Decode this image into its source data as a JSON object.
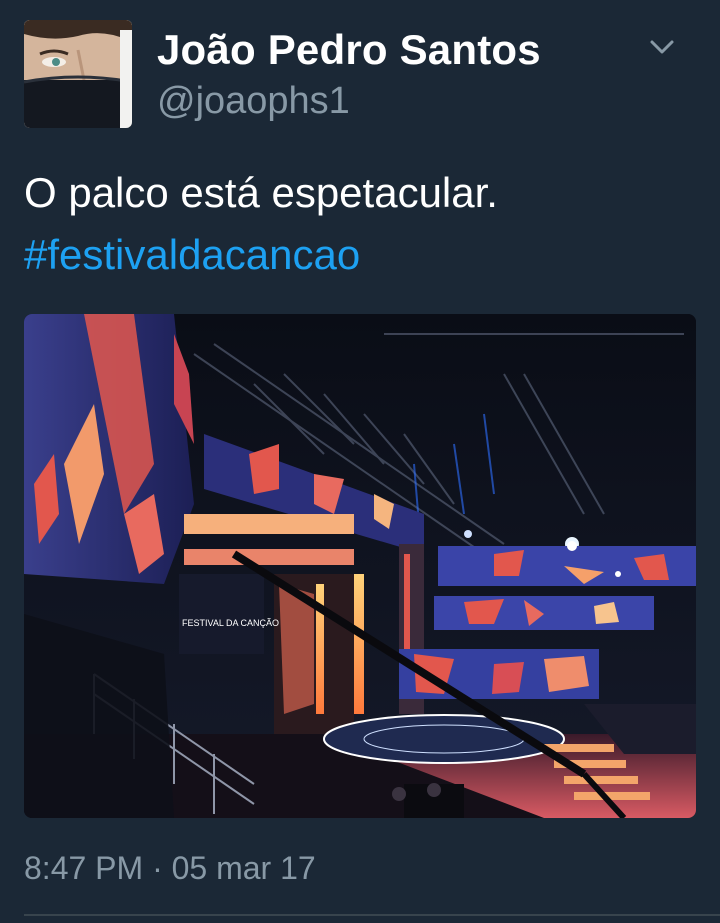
{
  "author": {
    "name": "João Pedro Santos",
    "handle": "@joaophs1"
  },
  "tweet": {
    "text": "O palco está espetacular.",
    "hashtag": "#festivaldacancao"
  },
  "photo": {
    "screen_text": "FESTIVAL DA CANÇÃO"
  },
  "meta": {
    "timestamp": "8:47 PM · 05 mar 17"
  },
  "icons": {
    "menu": "chevron-down-icon"
  },
  "colors": {
    "background": "#1b2836",
    "name": "#ffffff",
    "secondary": "#8899a6",
    "link": "#1da1f2"
  }
}
